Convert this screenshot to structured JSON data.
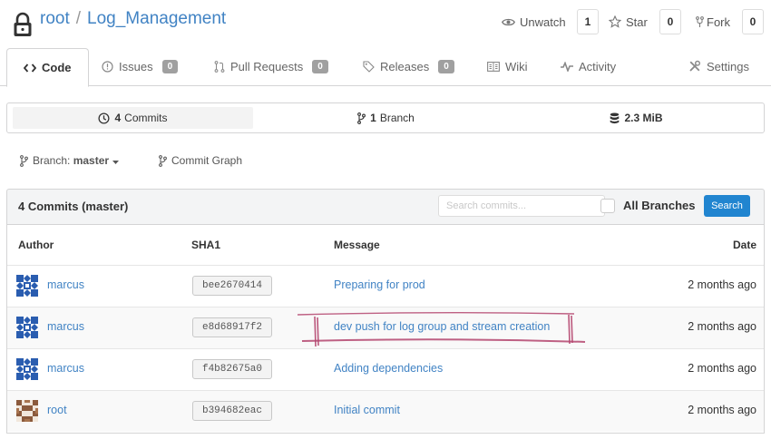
{
  "repo": {
    "owner": "root",
    "separator": "/",
    "name": "Log_Management"
  },
  "header_actions": [
    {
      "label": "Unwatch",
      "icon": "eye-icon",
      "count": "1"
    },
    {
      "label": "Star",
      "icon": "star-icon",
      "count": "0"
    },
    {
      "label": "Fork",
      "icon": "fork-icon",
      "count": "0"
    }
  ],
  "tabs": [
    {
      "label": "Code",
      "icon": "code-icon",
      "active": true
    },
    {
      "label": "Issues",
      "icon": "issue-icon",
      "badge": "0"
    },
    {
      "label": "Pull Requests",
      "icon": "pull-request-icon",
      "badge": "0"
    },
    {
      "label": "Releases",
      "icon": "tag-icon",
      "badge": "0"
    },
    {
      "label": "Wiki",
      "icon": "book-icon"
    },
    {
      "label": "Activity",
      "icon": "pulse-icon"
    },
    {
      "label": "Settings",
      "icon": "tools-icon"
    }
  ],
  "stats": {
    "commits_count": "4",
    "commits_label": "Commits",
    "branches_count": "1",
    "branches_label": "Branch",
    "size": "2.3 MiB"
  },
  "branch_selector": {
    "prefix": "Branch:",
    "value": "master"
  },
  "commit_graph_label": "Commit Graph",
  "commits_panel": {
    "title": "4 Commits (master)",
    "search_placeholder": "Search commits...",
    "all_branches_label": "All Branches",
    "search_button": "Search"
  },
  "table": {
    "columns": [
      "Author",
      "SHA1",
      "Message",
      "Date"
    ],
    "rows": [
      {
        "author": "marcus",
        "sha": "bee2670414",
        "message": "Preparing for prod",
        "date": "2 months ago"
      },
      {
        "author": "marcus",
        "sha": "e8d68917f2",
        "message": "dev push for log group and stream creation",
        "date": "2 months ago"
      },
      {
        "author": "marcus",
        "sha": "f4b82675a0",
        "message": "Adding dependencies",
        "date": "2 months ago"
      },
      {
        "author": "root",
        "sha": "b394682eac",
        "message": "Initial commit",
        "date": "2 months ago"
      }
    ]
  },
  "colors": {
    "link": "#4183c4",
    "primary_button": "#2185d0",
    "annotation_stroke": "#b4456e",
    "avatar_blue": "#2a5db0",
    "avatar_brown": "#8b5a3c"
  }
}
